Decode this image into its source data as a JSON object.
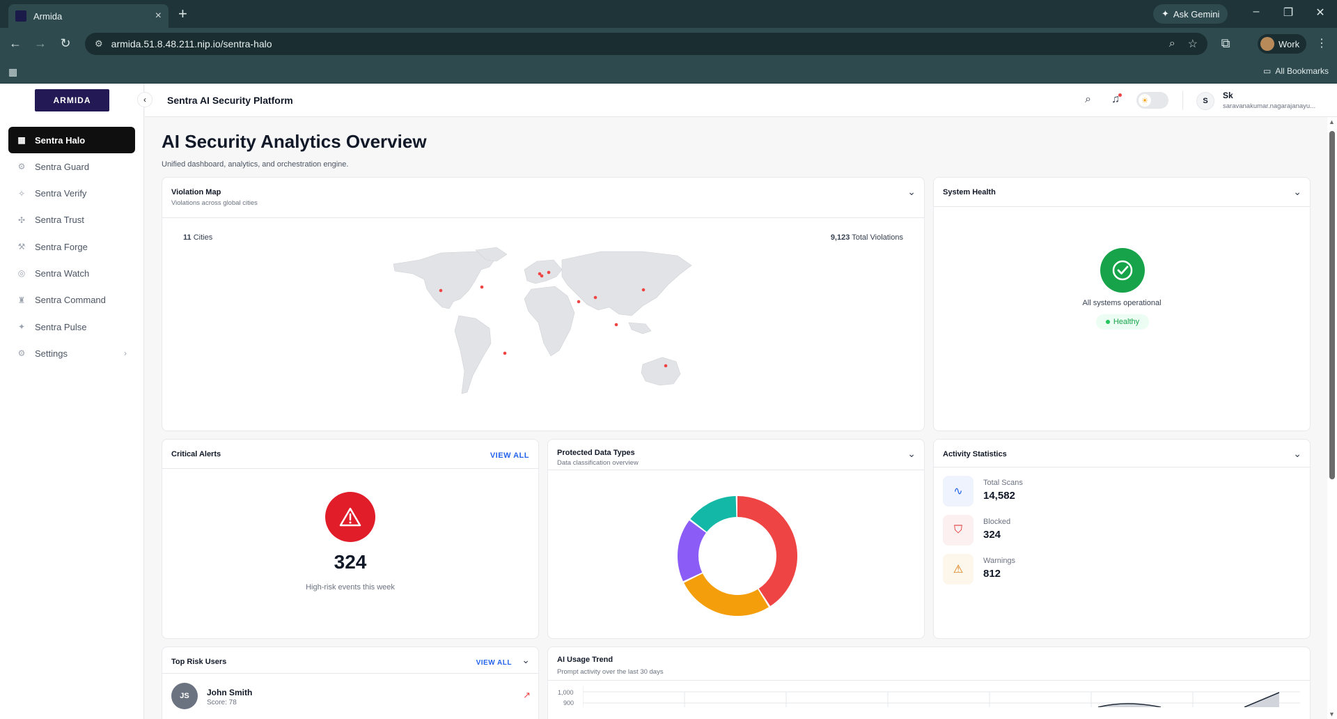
{
  "browser": {
    "tab_title": "Armida",
    "ask_gemini": "Ask Gemini",
    "url": "armida.51.8.48.211.nip.io/sentra-halo",
    "profile": "Work",
    "all_bookmarks": "All Bookmarks"
  },
  "app": {
    "logo_text": "ARMIDA",
    "header_title": "Sentra AI Security Platform",
    "user": {
      "initial": "S",
      "name": "Sk",
      "email": "saravanakumar.nagarajanayu..."
    }
  },
  "sidebar": {
    "items": [
      {
        "label": "Sentra Halo",
        "icon": "grid-icon",
        "glyph": "▦",
        "active": true
      },
      {
        "label": "Sentra Guard",
        "icon": "guard-icon",
        "glyph": "⚙"
      },
      {
        "label": "Sentra Verify",
        "icon": "verify-icon",
        "glyph": "✧"
      },
      {
        "label": "Sentra Trust",
        "icon": "trust-icon",
        "glyph": "✣"
      },
      {
        "label": "Sentra Forge",
        "icon": "forge-icon",
        "glyph": "⚒"
      },
      {
        "label": "Sentra Watch",
        "icon": "watch-icon",
        "glyph": "◎"
      },
      {
        "label": "Sentra Command",
        "icon": "command-icon",
        "glyph": "♜"
      },
      {
        "label": "Sentra Pulse",
        "icon": "pulse-icon",
        "glyph": "✦"
      },
      {
        "label": "Settings",
        "icon": "settings-icon",
        "glyph": "⚙"
      }
    ]
  },
  "page": {
    "title": "AI Security Analytics Overview",
    "subtitle": "Unified dashboard, analytics, and orchestration engine."
  },
  "violation_map": {
    "title": "Violation Map",
    "subtitle": "Violations across global cities",
    "cities_count": "11",
    "cities_label": "Cities",
    "total_count": "9,123",
    "total_label": "Total Violations"
  },
  "system_health": {
    "title": "System Health",
    "status_text": "All systems operational",
    "badge": "Healthy"
  },
  "critical_alerts": {
    "title": "Critical Alerts",
    "view_all": "VIEW ALL",
    "count": "324",
    "caption": "High-risk events this week"
  },
  "protected_data": {
    "title": "Protected Data Types",
    "subtitle": "Data classification overview"
  },
  "chart_data": {
    "type": "pie",
    "title": "Protected Data Types",
    "donut": true,
    "slices": [
      {
        "value": 40,
        "color": "#ef4444"
      },
      {
        "value": 26,
        "color": "#f59e0b"
      },
      {
        "value": 17,
        "color": "#8b5cf6"
      },
      {
        "value": 14,
        "color": "#14b8a6"
      }
    ]
  },
  "activity": {
    "title": "Activity Statistics",
    "stats": [
      {
        "label": "Total Scans",
        "value": "14,582",
        "icon": "activity-icon",
        "color": "#2563eb",
        "bg": "#eef3fd"
      },
      {
        "label": "Blocked",
        "value": "324",
        "icon": "shield-icon",
        "color": "#dc2626",
        "bg": "#fdf0f0"
      },
      {
        "label": "Warnings",
        "value": "812",
        "icon": "warning-icon",
        "color": "#d97706",
        "bg": "#fdf6ea"
      }
    ]
  },
  "top_risk_users": {
    "title": "Top Risk Users",
    "view_all": "VIEW ALL",
    "users": [
      {
        "initials": "JS",
        "name": "John Smith",
        "score": "Score: 78"
      }
    ]
  },
  "ai_usage": {
    "title": "AI Usage Trend",
    "subtitle": "Prompt activity over the last 30 days",
    "y_ticks": [
      "1,000",
      "900"
    ]
  }
}
